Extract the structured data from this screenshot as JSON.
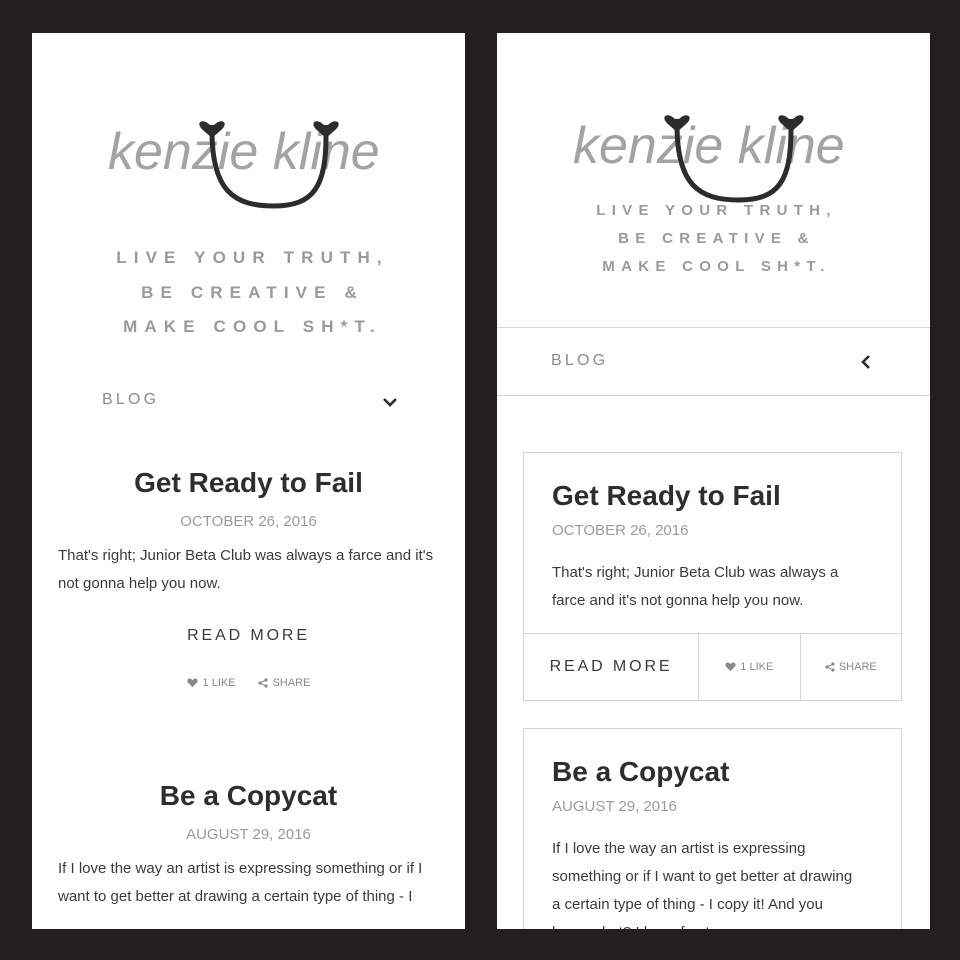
{
  "brand": {
    "logo_text": "kenzie kline"
  },
  "tagline": [
    "LIVE YOUR TRUTH,",
    "BE CREATIVE &",
    "MAKE COOL SH*T."
  ],
  "nav": {
    "label": "BLOG"
  },
  "posts": [
    {
      "title": "Get Ready to Fail",
      "date": "OCTOBER 26, 2016",
      "excerpt_left": [
        "That's right; Junior Beta Club was always a farce and it's",
        "not gonna help you now."
      ],
      "excerpt_right": [
        "That's right; Junior Beta Club was always a",
        "farce and it's not gonna help you now."
      ],
      "read_more": "READ MORE",
      "like": "1 LIKE",
      "share": "SHARE"
    },
    {
      "title": "Be a Copycat",
      "date": "AUGUST 29, 2016",
      "excerpt_left": [
        "If I love the way an artist is expressing something or if I",
        "want to get better at drawing a certain type of thing - I"
      ],
      "excerpt_right": [
        "If I love the way an artist is expressing",
        "something or if I want to get better at drawing",
        "a certain type of thing - I copy it! And you",
        "know what? I have fun too."
      ]
    }
  ],
  "colors": {
    "frame": "#231f20",
    "panel": "#ffffff",
    "logo_text": "#a3a3a3",
    "logo_accent": "#2c2c2c",
    "tagline": "#9a9a9a",
    "title": "#2e2e2e"
  }
}
